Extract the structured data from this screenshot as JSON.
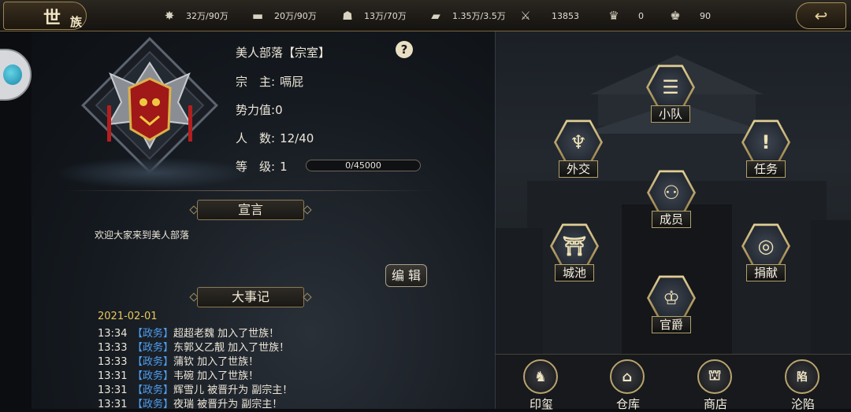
{
  "header": {
    "logo_main": "世",
    "logo_sub": "族",
    "resources": [
      {
        "icon": "grain-icon",
        "value": "32万/90万"
      },
      {
        "icon": "wood-icon",
        "value": "20万/90万"
      },
      {
        "icon": "stone-icon",
        "value": "13万/70万"
      },
      {
        "icon": "iron-icon",
        "value": "1.35万/3.5万"
      },
      {
        "icon": "order-icon",
        "value": "13853"
      },
      {
        "icon": "gold-ingot-icon",
        "value": "0"
      },
      {
        "icon": "silver-ingot-icon",
        "value": "90"
      }
    ],
    "back_glyph": "↩"
  },
  "clan": {
    "name": "美人部落【宗室】",
    "leader_label": "宗　主:",
    "leader_value": "嗝屁",
    "power_label": "势力值:",
    "power_value": "0",
    "members_label": "人　数:",
    "members_value": "12/40",
    "level_label": "等　级:",
    "level_value": "1",
    "exp_text": "0/45000",
    "exp_fraction": 0,
    "help_glyph": "?"
  },
  "declaration": {
    "title": "宣言",
    "text": "欢迎大家来到美人部落",
    "edit_label": "编 辑"
  },
  "events": {
    "title": "大事记",
    "date": "2021-02-01",
    "items": [
      {
        "time": "13:34",
        "tag": "【政务】",
        "text": "超超老魏 加入了世族！"
      },
      {
        "time": "13:33",
        "tag": "【政务】",
        "text": "东郭乂乙靓 加入了世族！"
      },
      {
        "time": "13:33",
        "tag": "【政务】",
        "text": "蒲钦 加入了世族！"
      },
      {
        "time": "13:31",
        "tag": "【政务】",
        "text": "韦碗 加入了世族！"
      },
      {
        "time": "13:31",
        "tag": "【政务】",
        "text": "辉雪儿 被晋升为 副宗主！"
      },
      {
        "time": "13:31",
        "tag": "【政务】",
        "text": "夜瑞 被晋升为 副宗主！"
      }
    ]
  },
  "nodes": {
    "squad": {
      "label": "小队",
      "icon": "squad-flags-icon",
      "glyph": "☰"
    },
    "diplomacy": {
      "label": "外交",
      "icon": "diplomacy-scroll-icon",
      "glyph": "♆"
    },
    "quest": {
      "label": "任务",
      "icon": "quest-scroll-icon",
      "glyph": "!"
    },
    "members": {
      "label": "成员",
      "icon": "members-icon",
      "glyph": "⚇"
    },
    "city": {
      "label": "城池",
      "icon": "city-gate-icon",
      "glyph": "⛩"
    },
    "donate": {
      "label": "捐献",
      "icon": "coin-icon",
      "glyph": "◎"
    },
    "rank": {
      "label": "官爵",
      "icon": "rank-hat-icon",
      "glyph": "♔"
    }
  },
  "bottom": [
    {
      "label": "印玺",
      "icon": "seal-icon",
      "glyph": "♞"
    },
    {
      "label": "仓库",
      "icon": "warehouse-icon",
      "glyph": "⌂"
    },
    {
      "label": "商店",
      "icon": "shop-icon",
      "glyph": "⛫"
    },
    {
      "label": "沦陷",
      "icon": "fallen-banner-icon",
      "glyph": "陷"
    }
  ]
}
